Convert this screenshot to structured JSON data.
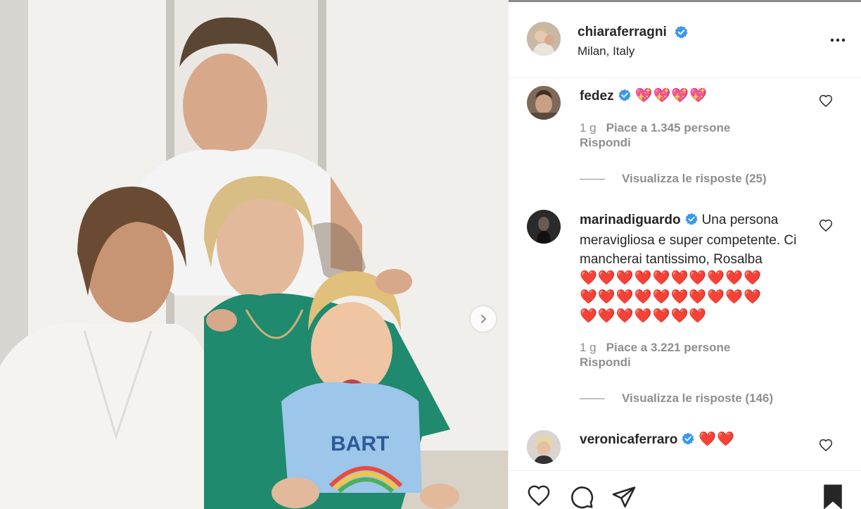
{
  "post": {
    "author": "chiaraferragni",
    "location": "Milan, Italy"
  },
  "comments": [
    {
      "username": "fedez",
      "text": "",
      "emojis": "💖💖💖💖",
      "time": "1 g",
      "likes": "Piace a 1.345 persone",
      "reply_label": "Rispondi",
      "view_replies": "Visualizza le risposte (25)"
    },
    {
      "username": "marinadiguardo",
      "text": "Una persona meravigliosa e super competente. Ci mancherai tantissimo, Rosalba",
      "emojis_line1": "❤️❤️❤️❤️❤️❤️❤️❤️❤️❤️",
      "emojis_line2": "❤️❤️❤️❤️❤️❤️❤️❤️❤️❤️",
      "emojis_line3": "❤️❤️❤️❤️❤️❤️❤️",
      "time": "1 g",
      "likes": "Piace a 3.221 persone",
      "reply_label": "Rispondi",
      "view_replies": "Visualizza le risposte (146)"
    },
    {
      "username": "veronicaferraro",
      "emojis": "❤️❤️"
    }
  ],
  "icons": {
    "verified": "verified-badge-icon",
    "more": "more-options-icon",
    "like": "heart-icon",
    "comment": "comment-icon",
    "share": "paper-plane-icon",
    "save": "bookmark-icon",
    "next": "chevron-right-icon"
  },
  "colors": {
    "verified_blue": "#3897f0",
    "muted_text": "#8e8e8e",
    "heart_red": "#e11d2c"
  }
}
